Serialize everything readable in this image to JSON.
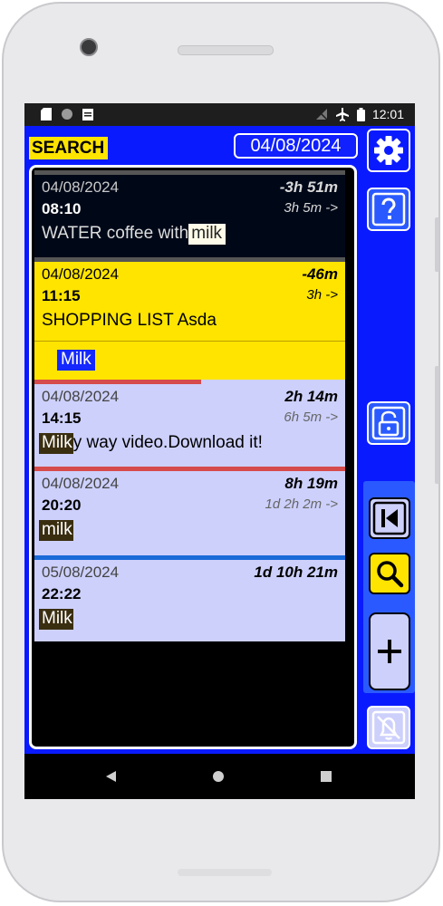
{
  "status_bar": {
    "time": "12:01"
  },
  "app": {
    "search_label": "SEARCH",
    "current_date": "04/08/2024",
    "colors": {
      "background": "#0a1aff",
      "highlight_yellow": "#ffe400",
      "item_lilac": "#cdd0fb",
      "dark_item": "#000818"
    }
  },
  "reminders": [
    {
      "date": "04/08/2024",
      "time": "08:10",
      "relative": "-3h 51m",
      "duration": "3h 5m ->",
      "title_before": "WATER coffee with",
      "title_match": "milk",
      "title_after": "",
      "style": "dark"
    },
    {
      "date": "04/08/2024",
      "time": "11:15",
      "relative": "-46m",
      "duration": "3h  ->",
      "title_before": "SHOPPING LIST Asda",
      "title_match": "",
      "title_after": "",
      "list_item": "Milk",
      "style": "yellow"
    },
    {
      "date": "04/08/2024",
      "time": "14:15",
      "relative": "2h 14m",
      "duration": "6h 5m ->",
      "title_before": "",
      "title_match": "Milk",
      "title_after": "y way video.Download it!",
      "style": "lilac"
    },
    {
      "date": "04/08/2024",
      "time": "20:20",
      "relative": "8h 19m",
      "duration": "1d 2h 2m ->",
      "title_before": "",
      "title_match": "milk",
      "title_after": "",
      "style": "lilac"
    },
    {
      "date": "05/08/2024",
      "time": "22:22",
      "relative": "1d 10h 21m",
      "duration": "",
      "title_before": "",
      "title_match": "Milk",
      "title_after": "",
      "style": "lilac"
    }
  ],
  "icons": {
    "settings": "gear-icon",
    "help": "question-icon",
    "lock": "unlock-icon",
    "first": "skip-to-start-icon",
    "search": "magnifier-icon",
    "add": "plus-icon",
    "notifications": "bell-off-icon"
  }
}
